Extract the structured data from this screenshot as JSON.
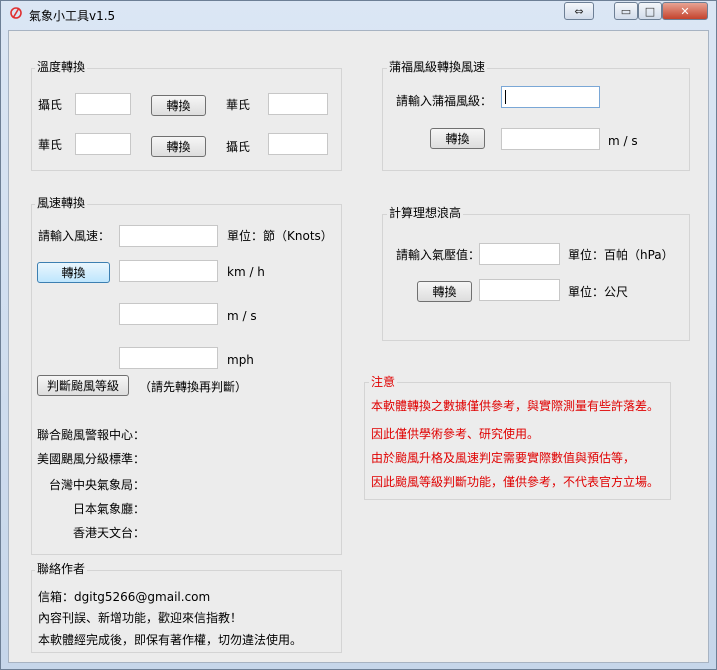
{
  "window": {
    "title": "氣象小工具v1.5"
  },
  "title_buttons": {
    "restore": "⇔",
    "minimize": "▭",
    "maximize": "□",
    "close": "✕"
  },
  "temperature": {
    "title": "溫度轉換",
    "row1": {
      "from_label": "攝氏",
      "button": "轉換",
      "to_label": "華氏",
      "from_value": "",
      "to_value": ""
    },
    "row2": {
      "from_label": "華氏",
      "button": "轉換",
      "to_label": "攝氏",
      "from_value": "",
      "to_value": ""
    }
  },
  "beaufort": {
    "title": "蒲福風級轉換風速",
    "prompt": "請輸入蒲福風級：",
    "button": "轉換",
    "unit": "m / s",
    "input_value": "",
    "result_value": ""
  },
  "wind": {
    "title": "風速轉換",
    "prompt": "請輸入風速：",
    "unit_label": "單位：節（Knots）",
    "button": "轉換",
    "units": [
      "km / h",
      "m / s",
      "mph"
    ],
    "judge_button": "判斷颱風等級",
    "judge_hint": "（請先轉換再判斷）",
    "agencies": [
      "聯合颱風警報中心：",
      "美國颶風分級標準：",
      "台灣中央氣象局：",
      "日本氣象廳：",
      "香港天文台："
    ]
  },
  "wave": {
    "title": "計算理想浪高",
    "prompt": "請輸入氣壓值：",
    "unit_pressure": "單位：百帕（hPa）",
    "button": "轉換",
    "unit_height": "單位：公尺"
  },
  "notice": {
    "title": "注意",
    "lines": [
      "本軟體轉換之數據僅供參考，與實際測量有些許落差。",
      "因此僅供學術參考、研究使用。",
      "由於颱風升格及風速判定需要實際數值與預估等，",
      "因此颱風等級判斷功能，僅供參考，不代表官方立場。"
    ]
  },
  "contact": {
    "title": "聯絡作者",
    "lines": [
      "信箱：dgitg5266@gmail.com",
      "內容刊誤、新增功能，歡迎來信指教！",
      "本軟體經完成後，即保有著作權，切勿違法使用。"
    ]
  },
  "colors": {
    "notice_text": "#e00000",
    "window_bg": "#ececec",
    "frame": "#c9d9ec"
  }
}
